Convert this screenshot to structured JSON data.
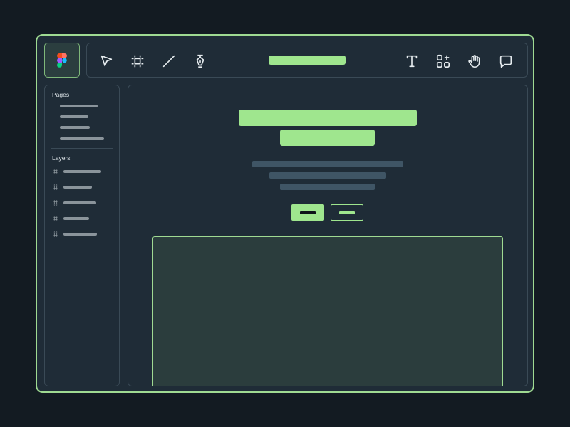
{
  "app": {
    "logo": "figma-logo",
    "accent": "#9fe68e",
    "background": "#131b22",
    "panel": "#1f2c37"
  },
  "toolbar": {
    "tools_left": [
      "move-icon",
      "frame-icon",
      "line-icon",
      "pen-icon"
    ],
    "tools_right": [
      "text-icon",
      "components-icon",
      "hand-icon",
      "comment-icon"
    ]
  },
  "pages": {
    "title": "Pages"
  },
  "layers": {
    "title": "Layers"
  }
}
